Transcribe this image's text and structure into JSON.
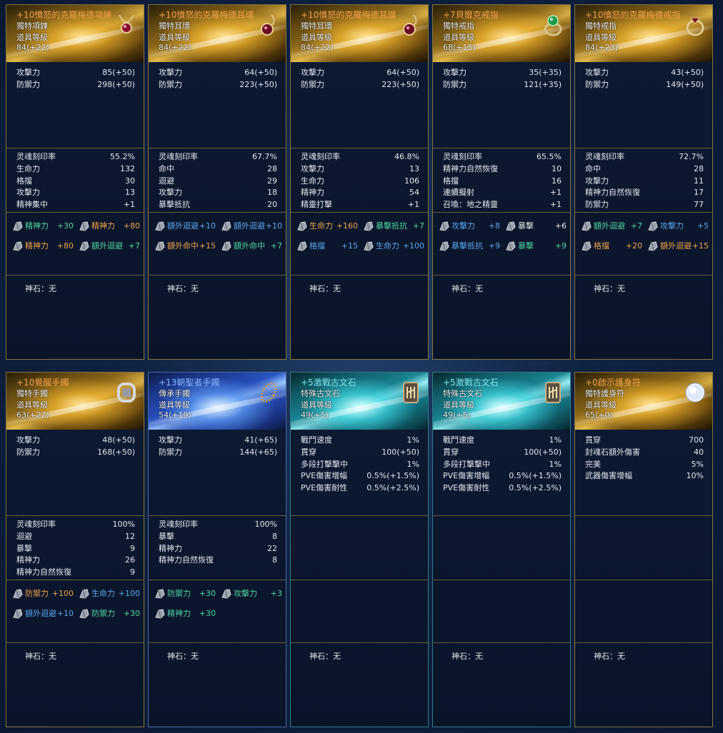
{
  "cards": [
    {
      "name": "+10憤怒的克羅梅德項鍊",
      "name_color": "orange",
      "theme": "gold",
      "icon": "necklace-icon",
      "sub": [
        "獨特項鍊",
        "道具等級",
        "84(+22)"
      ],
      "base": [
        [
          "攻擊力",
          "85(+50)"
        ],
        [
          "防禦力",
          "298(+50)"
        ]
      ],
      "stats": [
        [
          "灵魂刻印率",
          "55.2%"
        ],
        [
          "生命力",
          "132"
        ],
        [
          "格擋",
          "30"
        ],
        [
          "攻擊力",
          "13"
        ],
        [
          "精神集中",
          "+1"
        ]
      ],
      "bonus": [
        [
          "精神力",
          "+30",
          "green"
        ],
        [
          "精神力",
          "+80",
          "orange"
        ],
        [
          "精神力",
          "+80",
          "orange"
        ],
        [
          "額外迴避",
          "+7",
          "green"
        ]
      ],
      "godstone": "神石：无"
    },
    {
      "name": "+10憤怒的克羅梅德耳環",
      "name_color": "orange",
      "theme": "gold",
      "icon": "earring-icon",
      "sub": [
        "獨特耳環",
        "道具等級",
        "84(+22)"
      ],
      "base": [
        [
          "攻擊力",
          "64(+50)"
        ],
        [
          "防禦力",
          "223(+50)"
        ]
      ],
      "stats": [
        [
          "灵魂刻印率",
          "67.7%"
        ],
        [
          "命中",
          "28"
        ],
        [
          "迴避",
          "29"
        ],
        [
          "攻擊力",
          "18"
        ],
        [
          "暴擊抵抗",
          "20"
        ]
      ],
      "bonus": [
        [
          "額外迴避",
          "+10",
          "blue"
        ],
        [
          "額外迴避",
          "+10",
          "blue"
        ],
        [
          "額外命中",
          "+15",
          "orange"
        ],
        [
          "額外命中",
          "+7",
          "green"
        ]
      ],
      "godstone": "神石：无"
    },
    {
      "name": "+10憤怒的克羅梅德耳環",
      "name_color": "orange",
      "theme": "gold",
      "icon": "earring-icon",
      "sub": [
        "獨特耳環",
        "道具等級",
        "84(+22)"
      ],
      "base": [
        [
          "攻擊力",
          "64(+50)"
        ],
        [
          "防禦力",
          "223(+50)"
        ]
      ],
      "stats": [
        [
          "灵魂刻印率",
          "46.8%"
        ],
        [
          "攻擊力",
          "13"
        ],
        [
          "生命力",
          "106"
        ],
        [
          "精神力",
          "54"
        ],
        [
          "精靈打擊",
          "+1"
        ]
      ],
      "bonus": [
        [
          "生命力",
          "+160",
          "orange"
        ],
        [
          "暴擊抵抗",
          "+7",
          "green"
        ],
        [
          "格擋",
          "+15",
          "blue"
        ],
        [
          "生命力",
          "+100",
          "blue"
        ]
      ],
      "godstone": "神石：无"
    },
    {
      "name": "+7貝爾克戒指",
      "name_color": "orange",
      "theme": "gold",
      "icon": "emerald-ring-icon",
      "sub": [
        "獨特戒指",
        "道具等級",
        "68(+15)"
      ],
      "base": [
        [
          "攻擊力",
          "35(+35)"
        ],
        [
          "防禦力",
          "121(+35)"
        ]
      ],
      "stats": [
        [
          "灵魂刻印率",
          "65.5%"
        ],
        [
          "精神力自然恢復",
          "10"
        ],
        [
          "格擋",
          "16"
        ],
        [
          "連續擬射",
          "+1"
        ],
        [
          "召喚：地之精靈",
          "+1"
        ]
      ],
      "bonus": [
        [
          "攻擊力",
          "+8",
          "blue"
        ],
        [
          "暴擊",
          "+6",
          "white"
        ],
        [
          "暴擊抵抗",
          "+9",
          "blue"
        ],
        [
          "暴擊",
          "+9",
          "green"
        ]
      ],
      "godstone": "神石：无"
    },
    {
      "name": "+10憤怒的克羅梅德戒指",
      "name_color": "orange",
      "theme": "gold",
      "icon": "ring-icon",
      "sub": [
        "獨特戒指",
        "道具等級",
        "84(+23)"
      ],
      "base": [
        [
          "攻擊力",
          "43(+50)"
        ],
        [
          "防禦力",
          "149(+50)"
        ]
      ],
      "stats": [
        [
          "灵魂刻印率",
          "72.7%"
        ],
        [
          "命中",
          "28"
        ],
        [
          "攻擊力",
          "11"
        ],
        [
          "精神力自然恢復",
          "17"
        ],
        [
          "防禦力",
          "77"
        ]
      ],
      "bonus": [
        [
          "額外迴避",
          "+7",
          "green"
        ],
        [
          "攻擊力",
          "+5",
          "blue"
        ],
        [
          "格擋",
          "+20",
          "orange"
        ],
        [
          "額外迴避",
          "+15",
          "orange"
        ]
      ],
      "godstone": "神石：无"
    },
    {
      "name": "+10覺醒手鐲",
      "name_color": "orange",
      "theme": "gold",
      "icon": "bracelet-icon",
      "sub": [
        "獨特手鐲",
        "道具等級",
        "63(+22)"
      ],
      "base": [
        [
          "攻擊力",
          "48(+50)"
        ],
        [
          "防禦力",
          "168(+50)"
        ]
      ],
      "stats": [
        [
          "灵魂刻印率",
          "100%"
        ],
        [
          "迴避",
          "12"
        ],
        [
          "暴擊",
          "9"
        ],
        [
          "精神力",
          "26"
        ],
        [
          "精神力自然恢復",
          "9"
        ]
      ],
      "bonus": [
        [
          "防禦力",
          "+100",
          "orange"
        ],
        [
          "生命力",
          "+100",
          "blue"
        ],
        [
          "額外迴避",
          "+10",
          "blue"
        ],
        [
          "防禦力",
          "+30",
          "green"
        ]
      ],
      "godstone": "神石：无"
    },
    {
      "name": "+13朝聖者手鐲",
      "name_color": "blue",
      "theme": "blue",
      "icon": "beaded-bracelet-icon",
      "sub": [
        "傳承手鐲",
        "道具等級",
        "54(+19)"
      ],
      "base": [
        [
          "攻擊力",
          "41(+65)"
        ],
        [
          "防禦力",
          "144(+65)"
        ]
      ],
      "stats": [
        [
          "灵魂刻印率",
          "100%"
        ],
        [
          "暴擊",
          "8"
        ],
        [
          "精神力",
          "22"
        ],
        [
          "精神力自然恢復",
          "8"
        ]
      ],
      "bonus": [
        [
          "防禦力",
          "+30",
          "green"
        ],
        [
          "攻擊力",
          "+3",
          "green"
        ],
        [
          "精神力",
          "+30",
          "green"
        ]
      ],
      "godstone": "神石：无"
    },
    {
      "name": "+5激戰古文石",
      "name_color": "teal",
      "theme": "teal",
      "icon": "rune-stone-icon",
      "sub": [
        "特殊古文石",
        "道具等級",
        "49(+5)"
      ],
      "base": [
        [
          "戰鬥速度",
          "1%"
        ],
        [
          "貫穿",
          "100(+50)"
        ],
        [
          "多段打擊擊中",
          "1%"
        ],
        [
          "PVE傷害增幅",
          "0.5%(+1.5%)"
        ],
        [
          "PVE傷害耐性",
          "0.5%(+2.5%)"
        ]
      ],
      "stats": [],
      "bonus": [],
      "godstone": "神石：无"
    },
    {
      "name": "+5激戰古文石",
      "name_color": "teal",
      "theme": "teal",
      "icon": "rune-stone-icon",
      "sub": [
        "特殊古文石",
        "道具等級",
        "49(+5)"
      ],
      "base": [
        [
          "戰鬥速度",
          "1%"
        ],
        [
          "貫穿",
          "100(+50)"
        ],
        [
          "多段打擊擊中",
          "1%"
        ],
        [
          "PVE傷害增幅",
          "0.5%(+1.5%)"
        ],
        [
          "PVE傷害耐性",
          "0.5%(+2.5%)"
        ]
      ],
      "stats": [],
      "bonus": [],
      "godstone": "神石：无"
    },
    {
      "name": "+0啟示護身符",
      "name_color": "orange",
      "theme": "gold",
      "icon": "amulet-icon",
      "sub": [
        "獨特護身符",
        "道具等級",
        "65(+0)"
      ],
      "base": [
        [
          "貫穿",
          "700"
        ],
        [
          "封魂石額外傷害",
          "40"
        ],
        [
          "完美",
          "5%"
        ],
        [
          "武器傷害增幅",
          "10%"
        ]
      ],
      "stats": [],
      "bonus": [],
      "godstone": "神石：无"
    }
  ]
}
